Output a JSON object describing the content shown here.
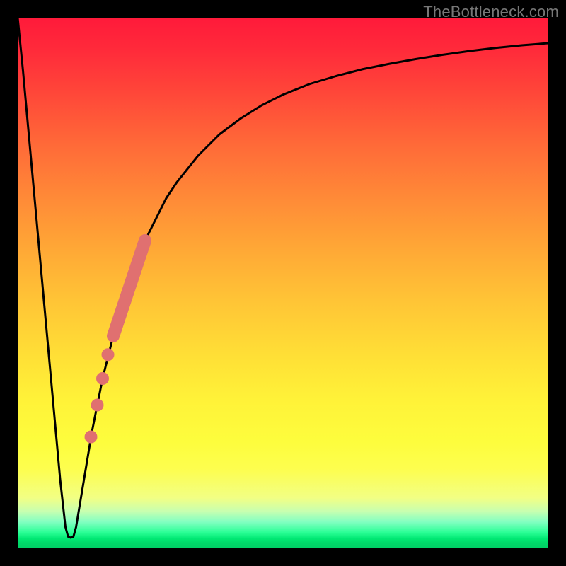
{
  "watermark": "TheBottleneck.com",
  "colors": {
    "frame": "#000000",
    "curve": "#000000",
    "marker": "#e07070",
    "gradient_top": "#ff1a3a",
    "gradient_bottom": "#00d066"
  },
  "chart_data": {
    "type": "line",
    "title": "",
    "xlabel": "",
    "ylabel": "",
    "xlim": [
      0,
      100
    ],
    "ylim": [
      0,
      100
    ],
    "grid": false,
    "legend": false,
    "series": [
      {
        "name": "bottleneck-curve",
        "x": [
          0,
          1,
          2,
          3,
          4,
          5,
          6,
          7,
          8,
          9,
          9.5,
          10,
          10.5,
          11,
          12,
          13,
          14,
          15,
          16,
          18,
          20,
          22,
          24,
          26,
          28,
          30,
          34,
          38,
          42,
          46,
          50,
          55,
          60,
          65,
          70,
          75,
          80,
          85,
          90,
          95,
          100
        ],
        "y": [
          100,
          90,
          79,
          68,
          57,
          46,
          35,
          24,
          13,
          4,
          2.2,
          2,
          2.2,
          4,
          10,
          16,
          22,
          27,
          32,
          40,
          47,
          53,
          58,
          62,
          66,
          69,
          74,
          78,
          81,
          83.5,
          85.5,
          87.5,
          89,
          90.3,
          91.3,
          92.2,
          93,
          93.7,
          94.3,
          94.8,
          95.2
        ]
      }
    ],
    "markers": [
      {
        "name": "highlight-segment",
        "type": "thick-line",
        "x": [
          18.0,
          24.0
        ],
        "y": [
          40.0,
          58.0
        ]
      },
      {
        "name": "dot-1",
        "type": "dot",
        "x": 17.0,
        "y": 36.5
      },
      {
        "name": "dot-2",
        "type": "dot",
        "x": 16.0,
        "y": 32.0
      },
      {
        "name": "dot-3",
        "type": "dot",
        "x": 15.0,
        "y": 27.0
      },
      {
        "name": "dot-4",
        "type": "dot",
        "x": 13.8,
        "y": 21.0
      }
    ]
  }
}
